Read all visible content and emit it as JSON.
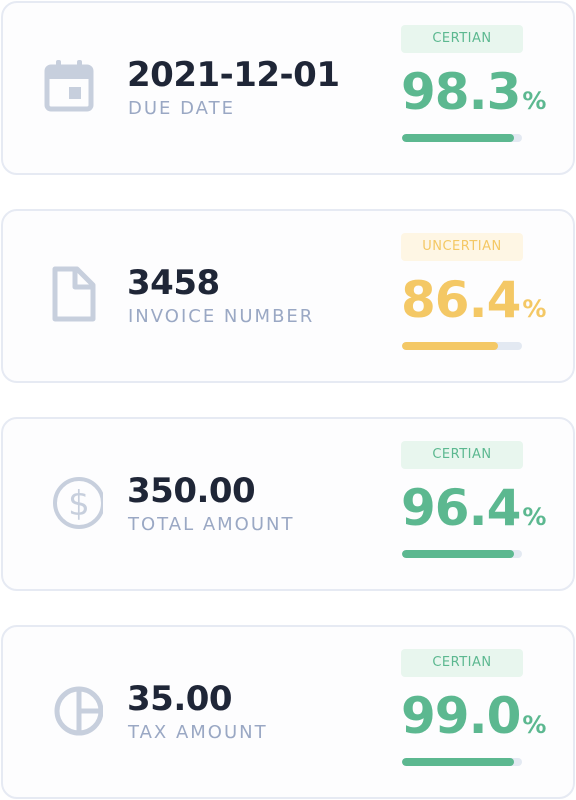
{
  "colors": {
    "certain": "#5cb890",
    "certain_badge_bg": "#e8f6ee",
    "uncertain": "#f4c865",
    "uncertain_badge_bg": "#fef6e4",
    "icon": "#c7cfdd"
  },
  "fields": [
    {
      "icon": "calendar-icon",
      "value": "2021-12-01",
      "label": "DUE DATE",
      "badge": "CERTIAN",
      "status": "certain",
      "confidence": "98.3",
      "percent_sign": "%",
      "confidence_fraction": 0.93
    },
    {
      "icon": "document-icon",
      "value": "3458",
      "label": "INVOICE NUMBER",
      "badge": "UNCERTIAN",
      "status": "uncertain",
      "confidence": "86.4",
      "percent_sign": "%",
      "confidence_fraction": 0.8
    },
    {
      "icon": "dollar-circle-icon",
      "value": "350.00",
      "label": "TOTAL AMOUNT",
      "badge": "CERTIAN",
      "status": "certain",
      "confidence": "96.4",
      "percent_sign": "%",
      "confidence_fraction": 0.93
    },
    {
      "icon": "pie-chart-icon",
      "value": "35.00",
      "label": "TAX AMOUNT",
      "badge": "CERTIAN",
      "status": "certain",
      "confidence": "99.0",
      "percent_sign": "%",
      "confidence_fraction": 0.93
    }
  ]
}
